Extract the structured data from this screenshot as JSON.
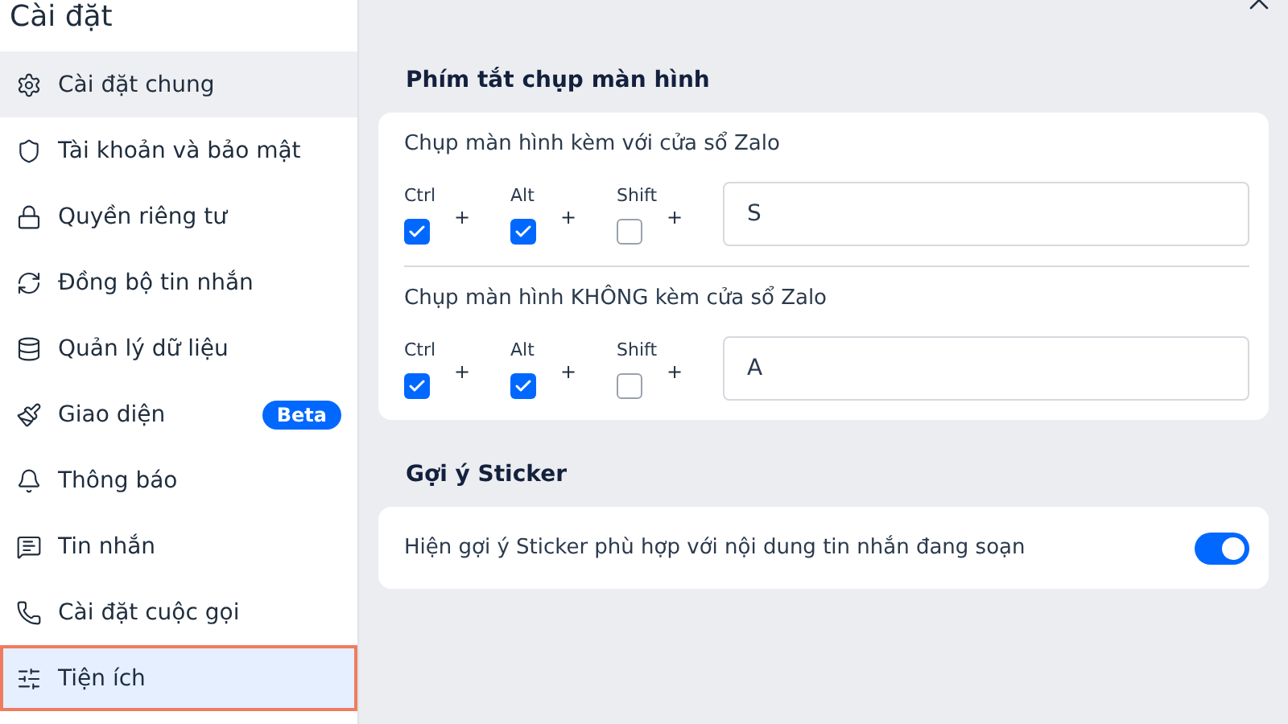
{
  "sidebar": {
    "title": "Cài đặt",
    "items": [
      {
        "label": "Cài đặt chung",
        "selected": false,
        "hovered": true
      },
      {
        "label": "Tài khoản và bảo mật",
        "selected": false,
        "hovered": false
      },
      {
        "label": "Quyền riêng tư",
        "selected": false,
        "hovered": false
      },
      {
        "label": "Đồng bộ tin nhắn",
        "selected": false,
        "hovered": false
      },
      {
        "label": "Quản lý dữ liệu",
        "selected": false,
        "hovered": false
      },
      {
        "label": "Giao diện",
        "selected": false,
        "hovered": false,
        "badge": "Beta"
      },
      {
        "label": "Thông báo",
        "selected": false,
        "hovered": false
      },
      {
        "label": "Tin nhắn",
        "selected": false,
        "hovered": false
      },
      {
        "label": "Cài đặt cuộc gọi",
        "selected": false,
        "hovered": false
      },
      {
        "label": "Tiện ích",
        "selected": true,
        "hovered": false
      }
    ]
  },
  "sections": [
    {
      "title": "Phím tắt chụp màn hình",
      "shortcuts": [
        {
          "label": "Chụp màn hình kèm với cửa sổ Zalo",
          "modifiers": [
            {
              "label": "Ctrl",
              "checked": true
            },
            {
              "label": "Alt",
              "checked": true
            },
            {
              "label": "Shift",
              "checked": false
            }
          ],
          "separator": "+",
          "key": "S"
        },
        {
          "label": "Chụp màn hình KHÔNG kèm cửa sổ Zalo",
          "modifiers": [
            {
              "label": "Ctrl",
              "checked": true
            },
            {
              "label": "Alt",
              "checked": true
            },
            {
              "label": "Shift",
              "checked": false
            }
          ],
          "separator": "+",
          "key": "A"
        }
      ]
    },
    {
      "title": "Gợi ý Sticker",
      "toggles": [
        {
          "label": "Hiện gợi ý Sticker phù hợp với nội dung tin nhắn đang soạn",
          "on": true
        }
      ]
    }
  ]
}
